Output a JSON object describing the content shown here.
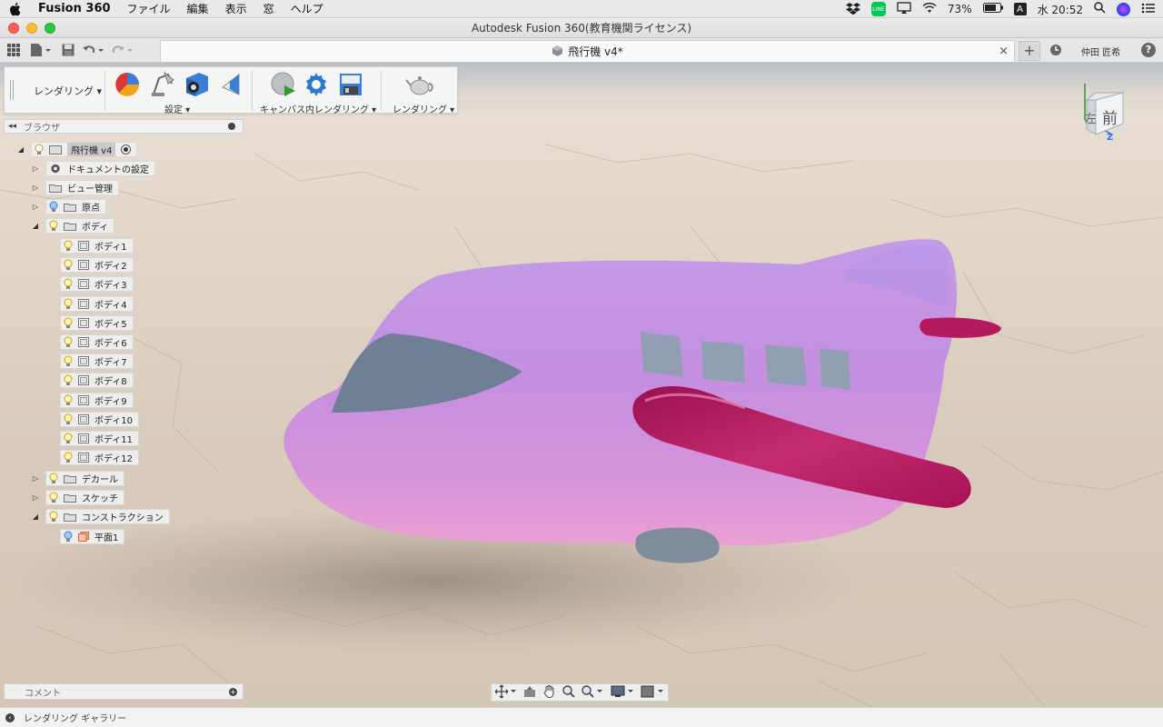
{
  "menubar": {
    "app": "Fusion 360",
    "items": [
      "ファイル",
      "編集",
      "表示",
      "窓",
      "ヘルプ"
    ],
    "battery": "73%",
    "clock": "水 20:52",
    "letter_icon": "A"
  },
  "window": {
    "title": "Autodesk Fusion 360(教育機関ライセンス)"
  },
  "toolbar": {
    "doc_tab": "飛行機 v4*",
    "close": "×",
    "plus": "+",
    "user": "仲田 匠希",
    "help": "?"
  },
  "ribbon": {
    "mode": "レンダリング ▾",
    "groups": [
      {
        "label": "設定 ▾"
      },
      {
        "label": "キャンバス内レンダリング ▾"
      },
      {
        "label": "レンダリング ▾"
      }
    ]
  },
  "browser": {
    "title": "ブラウザ",
    "collapse": "◂◂"
  },
  "tree": {
    "root": "飛行機 v4",
    "doc_settings": "ドキュメントの設定",
    "view": "ビュー管理",
    "origin": "原点",
    "bodies": "ボディ",
    "body_items": [
      "ボディ1",
      "ボディ2",
      "ボディ3",
      "ボディ4",
      "ボディ5",
      "ボディ6",
      "ボディ7",
      "ボディ8",
      "ボディ9",
      "ボディ10",
      "ボディ11",
      "ボディ12"
    ],
    "decal": "デカール",
    "sketch": "スケッチ",
    "construction": "コンストラクション",
    "plane": "平面1"
  },
  "viewcube": {
    "left": "左",
    "front": "前",
    "z": "Z"
  },
  "comment": {
    "label": "コメント"
  },
  "status": {
    "gallery": "レンダリング ギャラリー"
  },
  "colors": {
    "accent": "#0696d7",
    "plane_body": "#c48fe0",
    "wing": "#b5195e",
    "window": "#8fa0b0"
  }
}
